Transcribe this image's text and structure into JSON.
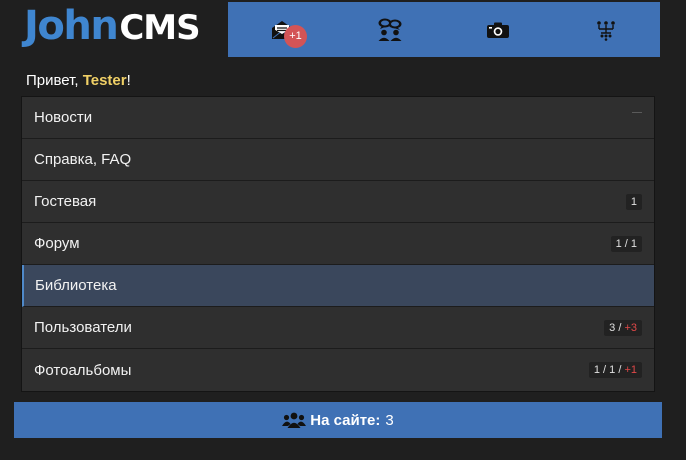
{
  "header": {
    "logo": {
      "part1": "John",
      "part2": "CMS"
    },
    "nav": [
      {
        "icon": "mail-icon",
        "badge": "+1"
      },
      {
        "icon": "users-talk-icon"
      },
      {
        "icon": "camera-icon"
      },
      {
        "icon": "sitemap-icon"
      }
    ]
  },
  "greeting": {
    "prefix": "Привет, ",
    "username": "Tester",
    "suffix": "!"
  },
  "menu": {
    "items": [
      {
        "label": "Новости"
      },
      {
        "label": "Справка, FAQ"
      },
      {
        "label": "Гостевая",
        "counter": "1"
      },
      {
        "label": "Форум",
        "counter": "1 / 1"
      },
      {
        "label": "Библиотека"
      },
      {
        "label": "Пользователи",
        "counter_base": "3 / ",
        "counter_new": "+3"
      },
      {
        "label": "Фотоальбомы",
        "counter_base": "1 / 1 / ",
        "counter_new": "+1"
      }
    ]
  },
  "footer": {
    "label": "На сайте:",
    "count": "3",
    "icon": "users-icon"
  },
  "colors": {
    "background": "#1f1f1f",
    "accent_blue": "#3f71b5",
    "logo_blue": "#3f86d0",
    "badge_red": "#d35456",
    "username_yellow": "#f0d066",
    "active_row": "#3a475c"
  }
}
